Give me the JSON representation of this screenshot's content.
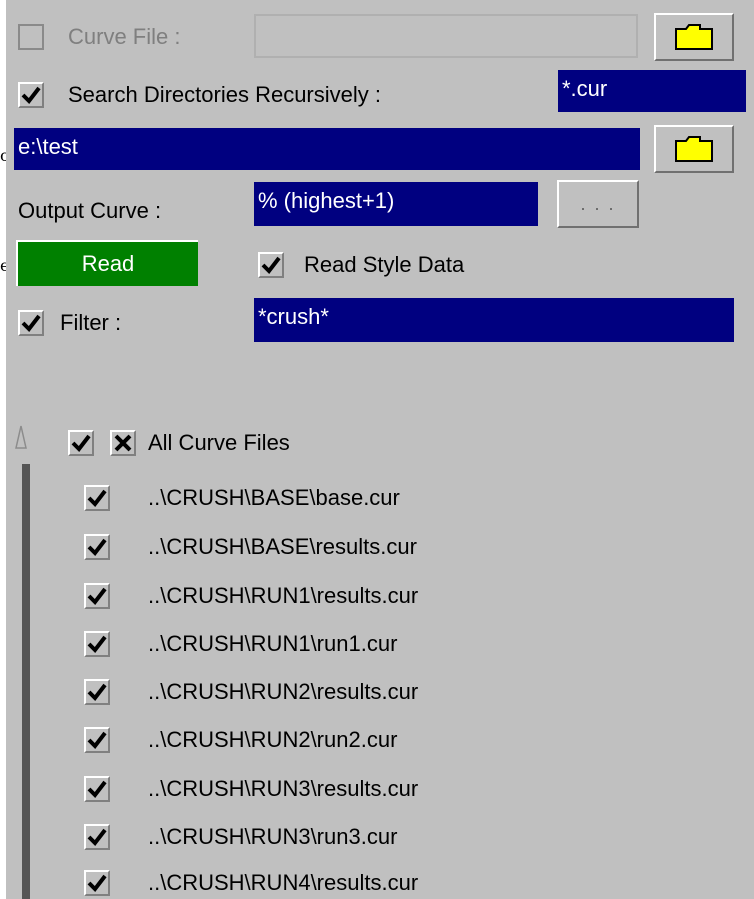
{
  "curve_file": {
    "label": "Curve File :",
    "value": ""
  },
  "search": {
    "label": "Search Directories Recursively :",
    "pattern": "*.cur"
  },
  "directory": {
    "value": "e:\\test"
  },
  "output": {
    "label": "Output Curve :",
    "value": "% (highest+1)",
    "more_label": ". . ."
  },
  "read": {
    "button_label": "Read",
    "style_label": "Read Style Data"
  },
  "filter": {
    "label": "Filter :",
    "value": "*crush*"
  },
  "list": {
    "header_label": "All Curve Files",
    "items": [
      {
        "label": "..\\CRUSH\\BASE\\base.cur"
      },
      {
        "label": "..\\CRUSH\\BASE\\results.cur"
      },
      {
        "label": "..\\CRUSH\\RUN1\\results.cur"
      },
      {
        "label": "..\\CRUSH\\RUN1\\run1.cur"
      },
      {
        "label": "..\\CRUSH\\RUN2\\results.cur"
      },
      {
        "label": "..\\CRUSH\\RUN2\\run2.cur"
      },
      {
        "label": "..\\CRUSH\\RUN3\\results.cur"
      },
      {
        "label": "..\\CRUSH\\RUN3\\run3.cur"
      },
      {
        "label": "..\\CRUSH\\RUN4\\results.cur"
      }
    ]
  },
  "edge_glyphs": {
    "a": "o",
    "b": "e"
  },
  "colors": {
    "field": "#000080",
    "read_button": "#008000",
    "panel": "#c0c0c0",
    "folder": "#ffff00"
  },
  "icons": [
    "folder-icon",
    "checkmark-icon",
    "cross-icon",
    "tree-expander-icon"
  ]
}
